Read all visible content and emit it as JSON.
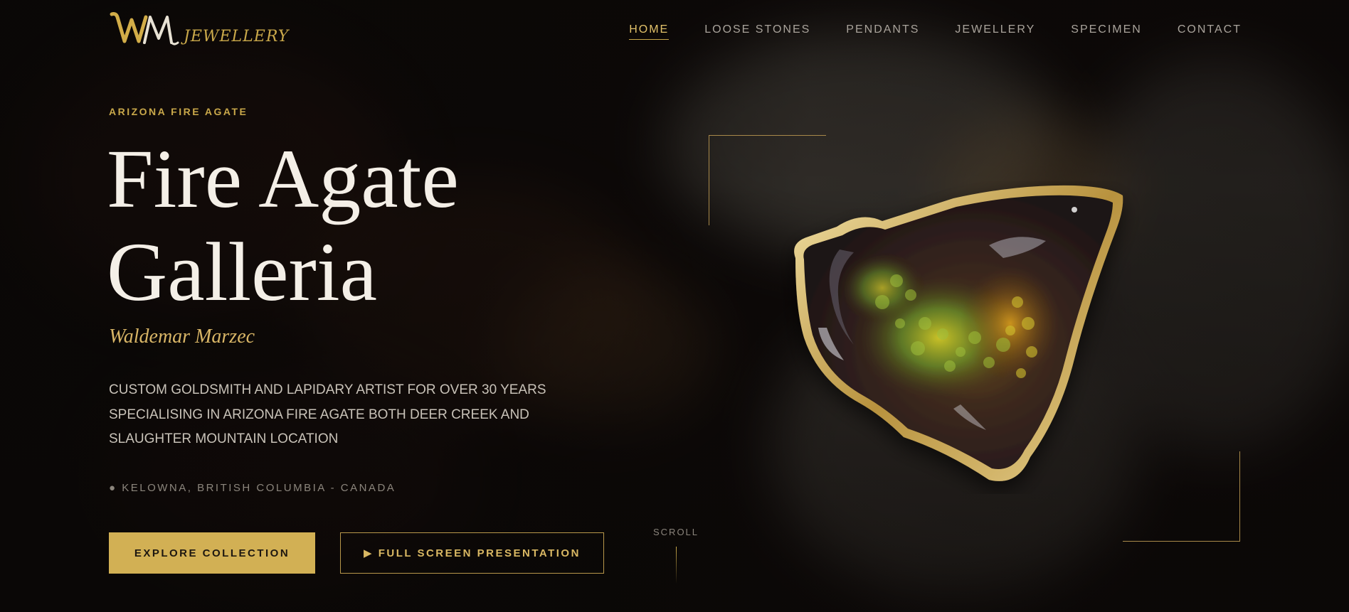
{
  "brand": {
    "logo_text": "JEWELLERY",
    "logo_monogram": "WM",
    "accent_color": "#c9a84a"
  },
  "nav": {
    "items": [
      {
        "label": "HOME",
        "active": true
      },
      {
        "label": "LOOSE STONES",
        "active": false
      },
      {
        "label": "PENDANTS",
        "active": false
      },
      {
        "label": "JEWELLERY",
        "active": false
      },
      {
        "label": "SPECIMEN",
        "active": false
      },
      {
        "label": "CONTACT",
        "active": false
      }
    ]
  },
  "hero": {
    "eyebrow": "ARIZONA FIRE AGATE",
    "title_line1": "Fire Agate",
    "title_line2": "Galleria",
    "author": "Waldemar Marzec",
    "description": "CUSTOM GOLDSMITH AND LAPIDARY ARTIST FOR OVER 30 YEARS SPECIALISING IN ARIZONA FIRE AGATE BOTH DEER CREEK AND SLAUGHTER MOUNTAIN LOCATION",
    "location": "● KELOWNA, BRITISH COLUMBIA - CANADA",
    "primary_button": "EXPLORE COLLECTION",
    "secondary_button": "▶ FULL SCREEN PRESENTATION",
    "scroll_label": "SCROLL"
  }
}
